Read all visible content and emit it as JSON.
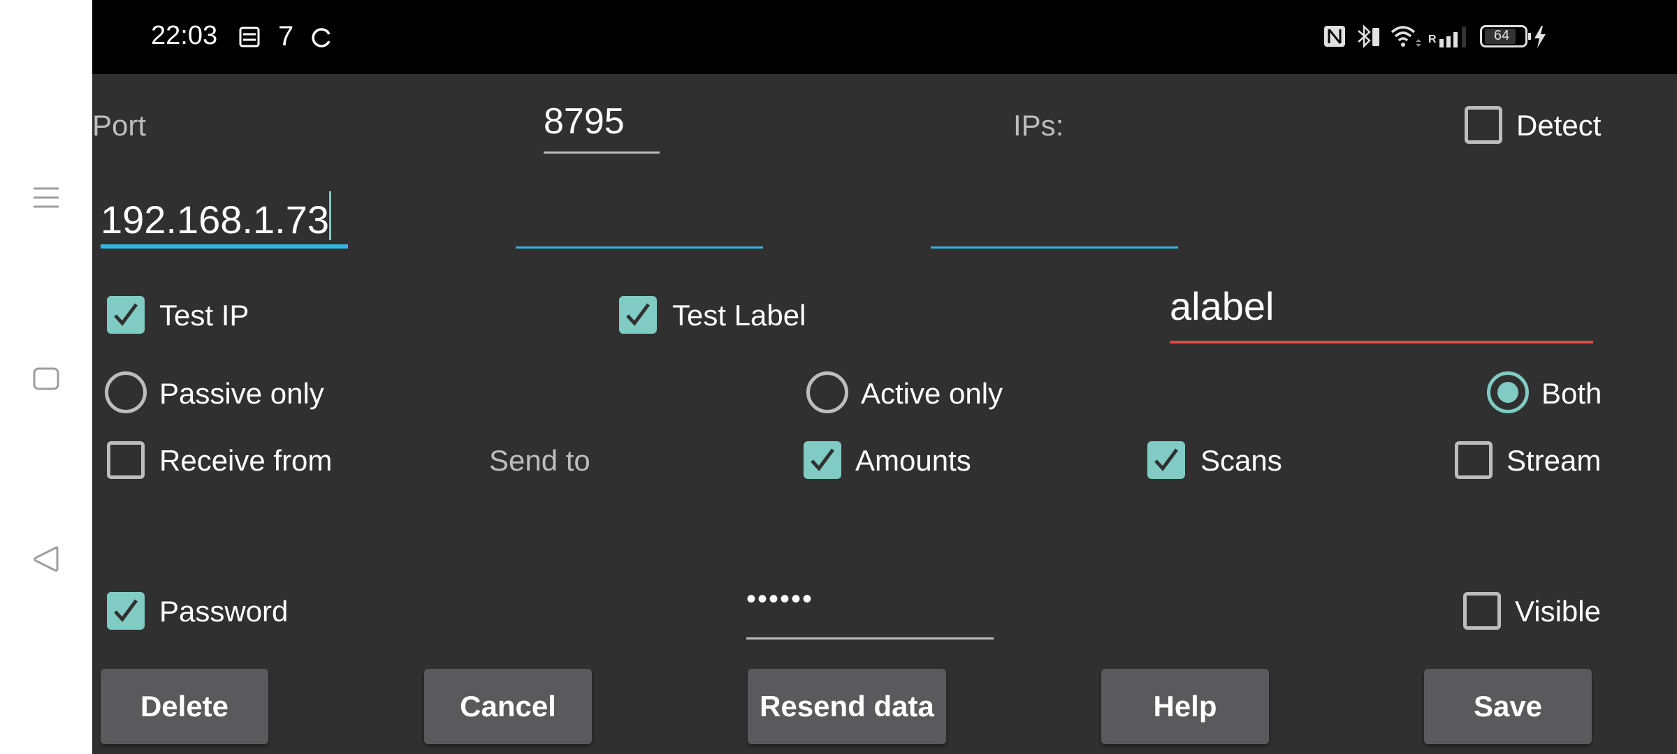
{
  "status_bar": {
    "time": "22:03",
    "notification_count": "7",
    "battery_level": "64",
    "network_roaming": "R",
    "icons": [
      "sim-card-icon",
      "sync-icon",
      "nfc-icon",
      "bluetooth-icon",
      "wifi-icon",
      "signal-icon",
      "battery-icon",
      "charging-icon"
    ]
  },
  "nav_bar": {
    "items": [
      "menu-icon",
      "home-icon",
      "back-icon"
    ]
  },
  "form": {
    "port_label": "Port",
    "port_value": "8795",
    "ips_label": "IPs:",
    "detect": {
      "label": "Detect",
      "checked": false
    },
    "ip_fields": [
      {
        "value": "192.168.1.73",
        "focused": true
      },
      {
        "value": "",
        "focused": false
      },
      {
        "value": "",
        "focused": false
      }
    ],
    "test_ip": {
      "label": "Test IP",
      "checked": true
    },
    "test_label": {
      "label": "Test Label",
      "checked": true
    },
    "label_value": "alabel",
    "mode_options": [
      {
        "label": "Passive only",
        "selected": false
      },
      {
        "label": "Active only",
        "selected": false
      },
      {
        "label": "Both",
        "selected": true
      }
    ],
    "receive_from": {
      "label": "Receive from",
      "checked": false
    },
    "send_to_label": "Send to",
    "amounts": {
      "label": "Amounts",
      "checked": true
    },
    "scans": {
      "label": "Scans",
      "checked": true
    },
    "stream": {
      "label": "Stream",
      "checked": false
    },
    "password": {
      "label": "Password",
      "checked": true
    },
    "password_value": "••••••",
    "visible": {
      "label": "Visible",
      "checked": false
    }
  },
  "buttons": {
    "delete": "Delete",
    "cancel": "Cancel",
    "resend": "Resend data",
    "help": "Help",
    "save": "Save"
  },
  "colors": {
    "accent": "#80cbc4",
    "focus_line": "#33b5e5",
    "error_line": "#e04848",
    "background": "#303030"
  }
}
